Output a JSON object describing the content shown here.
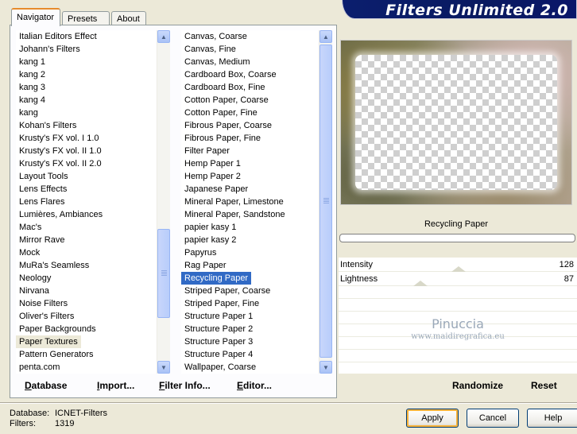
{
  "tabs": [
    {
      "label": "Navigator",
      "active": true
    },
    {
      "label": "Presets",
      "active": false
    },
    {
      "label": "About",
      "active": false
    }
  ],
  "header": {
    "title": "Filters Unlimited 2.0"
  },
  "categories": {
    "items": [
      "Italian Editors Effect",
      "Johann's Filters",
      "kang 1",
      "kang 2",
      "kang 3",
      "kang 4",
      "kang",
      "Kohan's Filters",
      "Krusty's FX vol. I 1.0",
      "Krusty's FX vol. II 1.0",
      "Krusty's FX vol. II 2.0",
      "Layout Tools",
      "Lens Effects",
      "Lens Flares",
      "Lumières, Ambiances",
      "Mac's",
      "Mirror Rave",
      "Mock",
      "MuRa's Seamless",
      "Neology",
      "Nirvana",
      "Noise Filters",
      "Oliver's Filters",
      "Paper Backgrounds",
      "Paper Textures",
      "Pattern Generators",
      "penta.com"
    ],
    "highlighted": "Paper Textures"
  },
  "filters": {
    "items": [
      "Canvas, Coarse",
      "Canvas, Fine",
      "Canvas, Medium",
      "Cardboard Box, Coarse",
      "Cardboard Box, Fine",
      "Cotton Paper, Coarse",
      "Cotton Paper, Fine",
      "Fibrous Paper, Coarse",
      "Fibrous Paper, Fine",
      "Filter Paper",
      "Hemp Paper 1",
      "Hemp Paper 2",
      "Japanese Paper",
      "Mineral Paper, Limestone",
      "Mineral Paper, Sandstone",
      "papier kasy 1",
      "papier kasy 2",
      "Papyrus",
      "Rag Paper",
      "Recycling Paper",
      "Striped Paper, Coarse",
      "Striped Paper, Fine",
      "Structure Paper 1",
      "Structure Paper 2",
      "Structure Paper 3",
      "Structure Paper 4",
      "Wallpaper, Coarse"
    ],
    "selected": "Recycling Paper"
  },
  "left_buttons": {
    "database": "Database",
    "import": "Import...",
    "filter_info": "Filter Info...",
    "editor": "Editor..."
  },
  "preview": {
    "filter_name": "Recycling Paper"
  },
  "parameters": [
    {
      "label": "Intensity",
      "value": "128"
    },
    {
      "label": "Lightness",
      "value": "87"
    }
  ],
  "watermark": {
    "line1": "Pinuccia",
    "line2": "www.maidiregrafica.eu"
  },
  "right_buttons": {
    "randomize": "Randomize",
    "reset": "Reset"
  },
  "status": {
    "database_label": "Database:",
    "database_value": "ICNET-Filters",
    "filters_label": "Filters:",
    "filters_value": "1319"
  },
  "dialog_buttons": {
    "apply": "Apply",
    "cancel": "Cancel",
    "help": "Help"
  },
  "colors": {
    "selection": "#316ac5",
    "banner": "#0b1e6e",
    "dialog_bg": "#ece9d8"
  }
}
